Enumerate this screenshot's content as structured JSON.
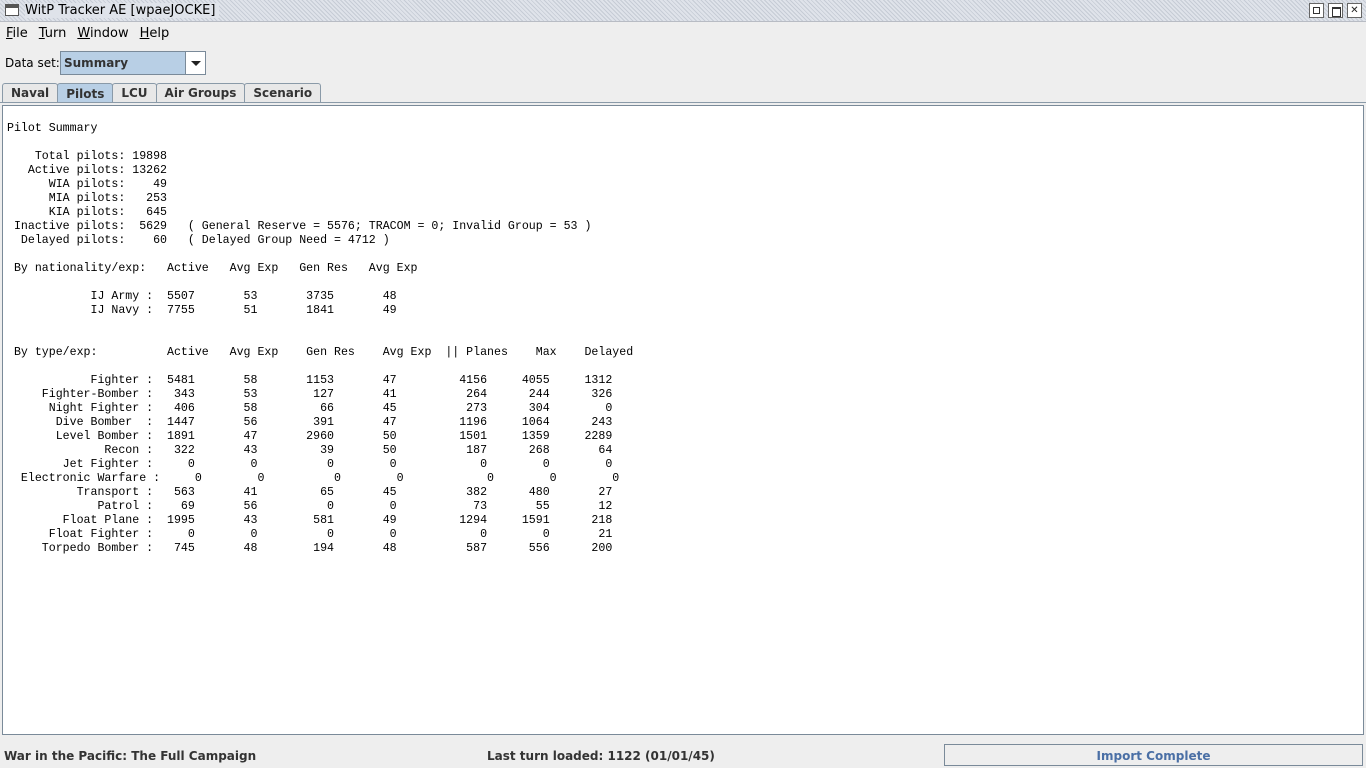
{
  "window": {
    "title": "WitP Tracker AE [wpaeJOCKE]",
    "controls": [
      "minimize-icon",
      "maximize-icon",
      "close-icon"
    ]
  },
  "menu": {
    "file": {
      "mnemonic": "F",
      "rest": "ile"
    },
    "turn": {
      "mnemonic": "T",
      "rest": "urn"
    },
    "window": {
      "mnemonic": "W",
      "rest": "indow"
    },
    "help": {
      "mnemonic": "H",
      "rest": "elp"
    }
  },
  "dataset": {
    "label": "Data set:",
    "selected": "Summary"
  },
  "tabs": [
    "Naval",
    "Pilots",
    "LCU",
    "Air Groups",
    "Scenario"
  ],
  "active_tab": "Pilots",
  "report": {
    "title": "Pilot Summary",
    "totals": [
      "    Total pilots: 19898",
      "",
      "   Active pilots: 13262",
      "      WIA pilots:    49",
      "      MIA pilots:   253",
      "      KIA pilots:   645",
      " Inactive pilots:  5629   ( General Reserve = 5576; TRACOM = 0; Invalid Group = 53 )",
      "  Delayed pilots:    60   ( Delayed Group Need = 4712 )"
    ],
    "nationality_header": " By nationality/exp:   Active   Avg Exp   Gen Res   Avg Exp",
    "nationality_rows": [
      "            IJ Army :  5507       53       3735       48",
      "            IJ Navy :  7755       51       1841       49"
    ],
    "type_header": " By type/exp:          Active   Avg Exp    Gen Res    Avg Exp  || Planes    Max    Delayed",
    "type_rows": [
      "            Fighter :  5481       58       1153       47         4156     4055     1312",
      "     Fighter-Bomber :   343       53        127       41          264      244      326",
      "      Night Fighter :   406       58         66       45          273      304        0",
      "       Dive Bomber  :  1447       56        391       47         1196     1064      243",
      "       Level Bomber :  1891       47       2960       50         1501     1359     2289",
      "              Recon :   322       43         39       50          187      268       64",
      "        Jet Fighter :     0        0          0        0            0        0        0",
      "  Electronic Warfare :     0        0          0        0            0        0        0",
      "          Transport :   563       41         65       45          382      480       27",
      "             Patrol :    69       56          0        0           73       55       12",
      "        Float Plane :  1995       43        581       49         1294     1591      218",
      "      Float Fighter :     0        0          0        0            0        0       21",
      "     Torpedo Bomber :   745       48        194       48          587      556      200"
    ]
  },
  "status": {
    "campaign": "War in the Pacific: The Full Campaign",
    "last_turn": "Last turn loaded: 1122 (01/01/45)",
    "import_status": "Import Complete",
    "import_progress": 1.0
  }
}
